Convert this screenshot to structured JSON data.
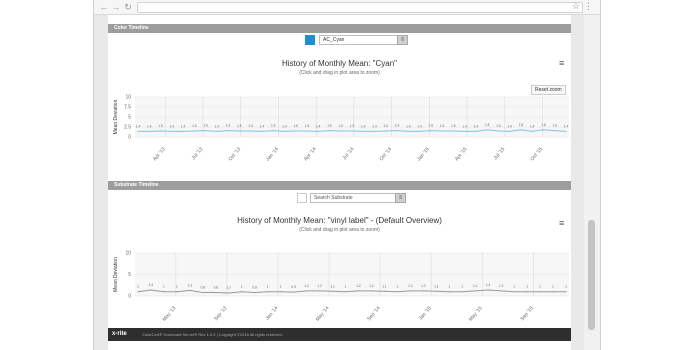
{
  "browser": {
    "back_icon": "back-arrow-icon",
    "forward_icon": "forward-arrow-icon",
    "reload_icon": "reload-icon",
    "bookmark_icon": "star-icon",
    "menu_icon": "vertical-dots-icon"
  },
  "color_section": {
    "title": "Color Timeline",
    "select_value": "AC_Cyan",
    "swatch_color": "#1e8fd0",
    "dropdown_label": "≡"
  },
  "substrate_section": {
    "title": "Substrate Timeline",
    "select_placeholder": "Search Substrate",
    "dropdown_label": "≡"
  },
  "charts": {
    "cyan": {
      "title": "History of Monthly Mean: \"Cyan\"",
      "subtitle": "(Click and drag in plot area to zoom)",
      "reset_zoom": "Reset zoom",
      "menu": "≡"
    },
    "vinyl": {
      "title": "History of Monthly Mean: \"vinyl label\" - (Default Overview)",
      "subtitle": "(Click and drag in plot area to zoom)",
      "menu": "≡"
    }
  },
  "chart_data": [
    {
      "type": "line",
      "title": "History of Monthly Mean: \"Cyan\"",
      "ylabel": "Mean Deviation",
      "ylim": [
        0,
        10
      ],
      "yticks": [
        0,
        2.5,
        5,
        7.5,
        10
      ],
      "x_tick_labels": [
        "Apr '13",
        "Jul '13",
        "Oct '13",
        "Jan '14",
        "Apr '14",
        "Jul '14",
        "Oct '14",
        "Jan '15",
        "Apr '15",
        "Jul '15",
        "Oct '15"
      ],
      "color": "#7cc4e8",
      "values": [
        1.4,
        1.4,
        1.5,
        1.4,
        1.4,
        1.5,
        1.6,
        1.4,
        1.6,
        1.5,
        1.5,
        1.4,
        1.6,
        1.4,
        1.5,
        1.5,
        1.4,
        1.6,
        1.5,
        1.5,
        1.4,
        1.4,
        1.5,
        1.6,
        1.4,
        1.4,
        1.6,
        1.5,
        1.5,
        1.4,
        1.4,
        1.8,
        1.5,
        1.4,
        1.8,
        1.4,
        1.8,
        1.6,
        1.4
      ],
      "grid": true
    },
    {
      "type": "line",
      "title": "History of Monthly Mean: \"vinyl label\" - (Default Overview)",
      "ylabel": "Mean Deviation",
      "ylim": [
        0,
        10
      ],
      "yticks": [
        0,
        5,
        10
      ],
      "x_tick_labels": [
        "May '13",
        "Sep '13",
        "Jan '14",
        "May '14",
        "Sep '14",
        "Jan '15",
        "May '15",
        "Sep '15"
      ],
      "color": "#999999",
      "values": [
        1,
        1.4,
        1,
        1,
        1.3,
        0.8,
        0.8,
        0.7,
        1,
        0.8,
        1,
        1,
        0.9,
        1.2,
        1.2,
        1.1,
        1,
        1.2,
        1.2,
        1.1,
        1,
        1.2,
        1.2,
        1.1,
        1,
        1,
        1.2,
        1.4,
        1.2,
        1,
        1,
        1,
        1,
        1
      ],
      "grid": true
    }
  ],
  "footer": {
    "logo": "x-rite",
    "text": "ColorCert® Scorecard Server® Rev 1.0.0 | Copyright ©2016 All rights reserved."
  }
}
